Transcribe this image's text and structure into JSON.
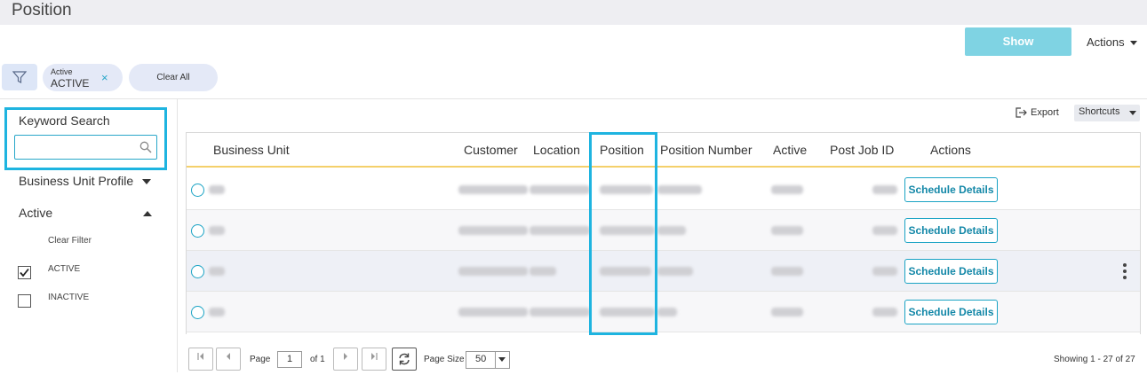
{
  "header": {
    "title": "Position"
  },
  "toolbar": {
    "show_label": "Show",
    "actions_label": "Actions"
  },
  "filters": {
    "chip": {
      "category": "Active",
      "value": "ACTIVE",
      "remove": "×"
    },
    "clear_all": "Clear All"
  },
  "sidebar": {
    "keyword_label": "Keyword Search",
    "keyword_value": "",
    "business_unit_profile": "Business Unit Profile",
    "active_section": "Active",
    "clear_filter": "Clear Filter",
    "options": [
      {
        "label": "ACTIVE",
        "checked": true
      },
      {
        "label": "INACTIVE",
        "checked": false
      }
    ]
  },
  "grid_toolbar": {
    "export_label": "Export",
    "shortcuts_label": "Shortcuts"
  },
  "grid": {
    "columns": [
      "Business Unit",
      "Customer",
      "Location",
      "Position",
      "Position Number",
      "Active",
      "Post Job ID",
      "Actions"
    ],
    "row_action_label": "Schedule Details",
    "row_count": 4
  },
  "pager": {
    "page_label": "Page",
    "page_value": "1",
    "of_label": "of 1",
    "page_size_label": "Page Size",
    "page_size_value": "50",
    "showing": "Showing 1 - 27 of 27"
  },
  "colors": {
    "accent": "#1eb4e0",
    "show_button": "#7fd3e3",
    "header_underline": "#f4d06b"
  }
}
